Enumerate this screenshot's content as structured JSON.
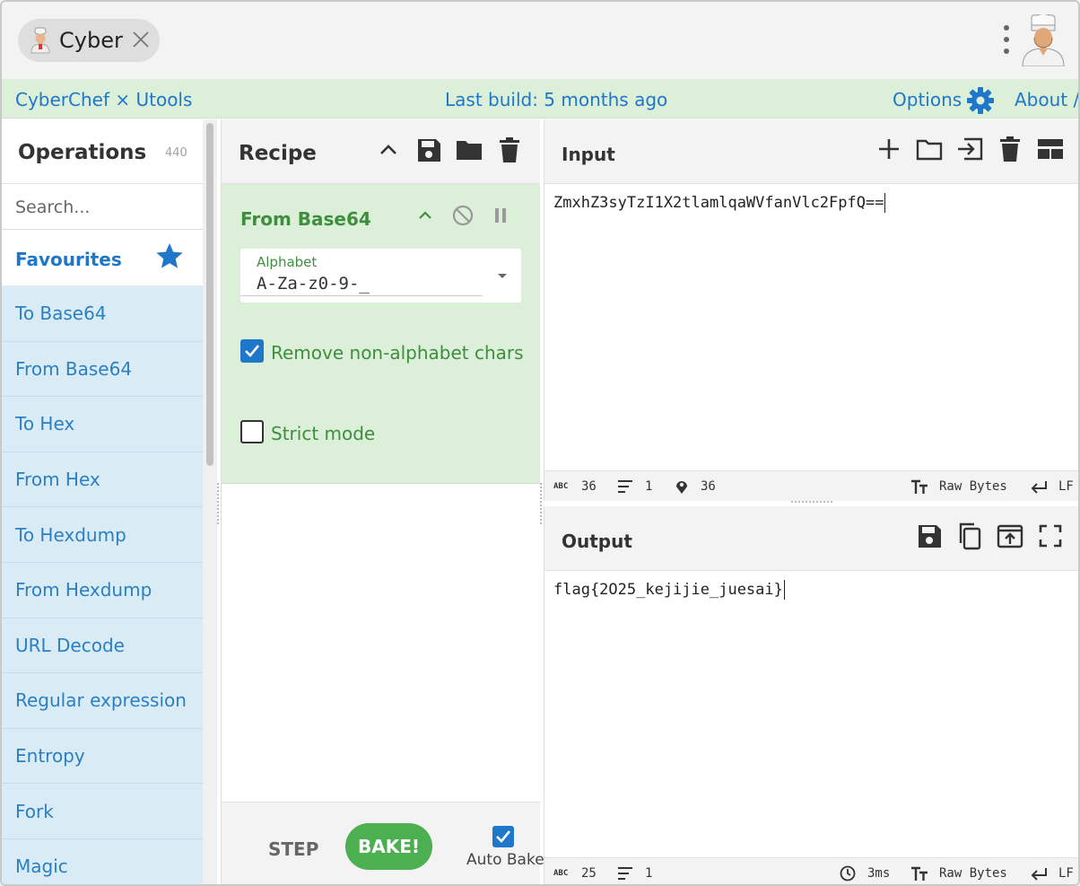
{
  "window": {
    "tab_title": "Cyber"
  },
  "banner": {
    "brand": "CyberChef × Utools",
    "last_build": "Last build: 5 months ago",
    "options": "Options",
    "about": "About /"
  },
  "operations": {
    "title": "Operations",
    "count": "440",
    "search_placeholder": "Search...",
    "favourites_label": "Favourites",
    "items": [
      "To Base64",
      "From Base64",
      "To Hex",
      "From Hex",
      "To Hexdump",
      "From Hexdump",
      "URL Decode",
      "Regular expression",
      "Entropy",
      "Fork",
      "Magic"
    ]
  },
  "recipe": {
    "title": "Recipe",
    "operation": {
      "name": "From Base64",
      "alphabet_label": "Alphabet",
      "alphabet_value": "A-Za-z0-9-_",
      "remove_nonalpha_label": "Remove non-alphabet chars",
      "remove_nonalpha_checked": true,
      "strict_mode_label": "Strict mode",
      "strict_mode_checked": false
    },
    "step_label": "STEP",
    "bake_label": "BAKE!",
    "auto_bake_label": "Auto Bake",
    "auto_bake_checked": true
  },
  "input": {
    "title": "Input",
    "text": "ZmxhZ3syTzI1X2tlamlqaWVfanVlc2FpfQ==",
    "status": {
      "abc_label": "ABC",
      "length": "36",
      "lines": "1",
      "position": "36",
      "encoding": "Raw Bytes",
      "eol": "LF"
    }
  },
  "output": {
    "title": "Output",
    "text": "flag{2O25_kejijie_juesai}",
    "status": {
      "abc_label": "ABC",
      "length": "25",
      "lines": "1",
      "time": "3ms",
      "encoding": "Raw Bytes",
      "eol": "LF"
    }
  },
  "colors": {
    "accent_blue": "#1f77c9",
    "op_green": "#3f8e3f",
    "bake_green": "#4caf50",
    "fav_bg": "#d9ecf5",
    "card_bg": "#dcefd9"
  }
}
